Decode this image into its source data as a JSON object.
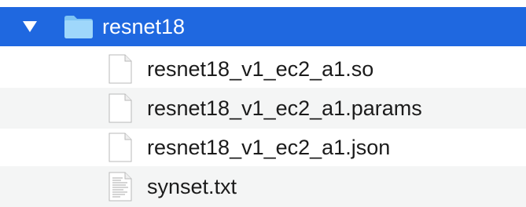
{
  "folder": {
    "name": "resnet18",
    "expanded": true,
    "selected": true,
    "icon": "folder-icon",
    "accent_color": "#1f68e0"
  },
  "files": [
    {
      "name": "resnet18_v1_ec2_a1.so",
      "icon": "blank-document-icon"
    },
    {
      "name": "resnet18_v1_ec2_a1.params",
      "icon": "blank-document-icon"
    },
    {
      "name": "resnet18_v1_ec2_a1.json",
      "icon": "blank-document-icon"
    },
    {
      "name": "synset.txt",
      "icon": "text-document-icon"
    }
  ]
}
